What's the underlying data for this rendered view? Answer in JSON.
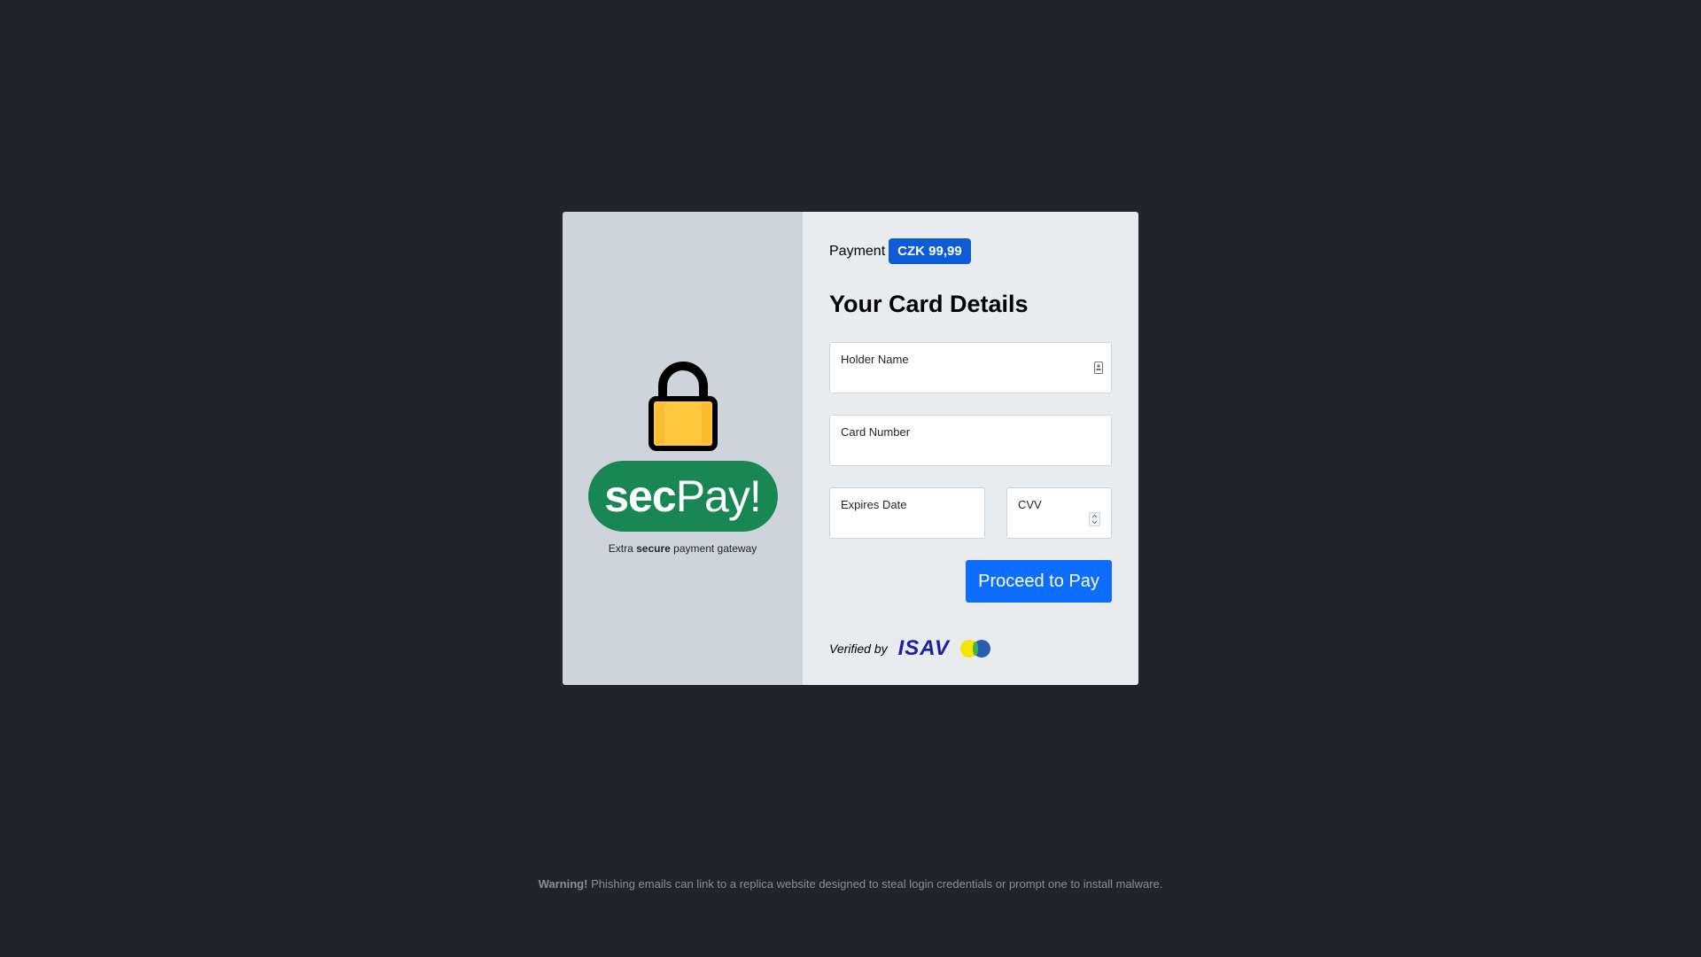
{
  "brand": {
    "name_strong": "sec",
    "name_light": "Pay!",
    "tagline_prefix": "Extra",
    "tagline_strong": "secure",
    "tagline_suffix": "payment gateway"
  },
  "payment": {
    "label": "Payment",
    "amount": "CZK 99,99"
  },
  "form": {
    "title": "Your Card Details",
    "holder_name_label": "Holder Name",
    "card_number_label": "Card Number",
    "expires_label": "Expires Date",
    "cvv_label": "CVV",
    "submit_label": "Proceed to Pay"
  },
  "verification": {
    "text": "Verified by",
    "network_logo": "ISAV",
    "second_logo_icon": "card-network-circles-icon"
  },
  "footer": {
    "warning_strong": "Warning!",
    "warning_text": "Phishing emails can link to a replica website designed to steal login credentials or prompt one to install malware."
  },
  "colors": {
    "page_background": "#212529",
    "left_pane": "#ced4da",
    "right_pane": "#e9ecef",
    "brand_green": "#198754",
    "badge_blue": "#0d5bd6",
    "button_blue": "#0d6efd",
    "lock_gold": "#ffc83d"
  },
  "icons": {
    "lock": "padlock-icon",
    "holder_field": "contact-card-icon",
    "cvv_field": "number-spinner-icon"
  }
}
